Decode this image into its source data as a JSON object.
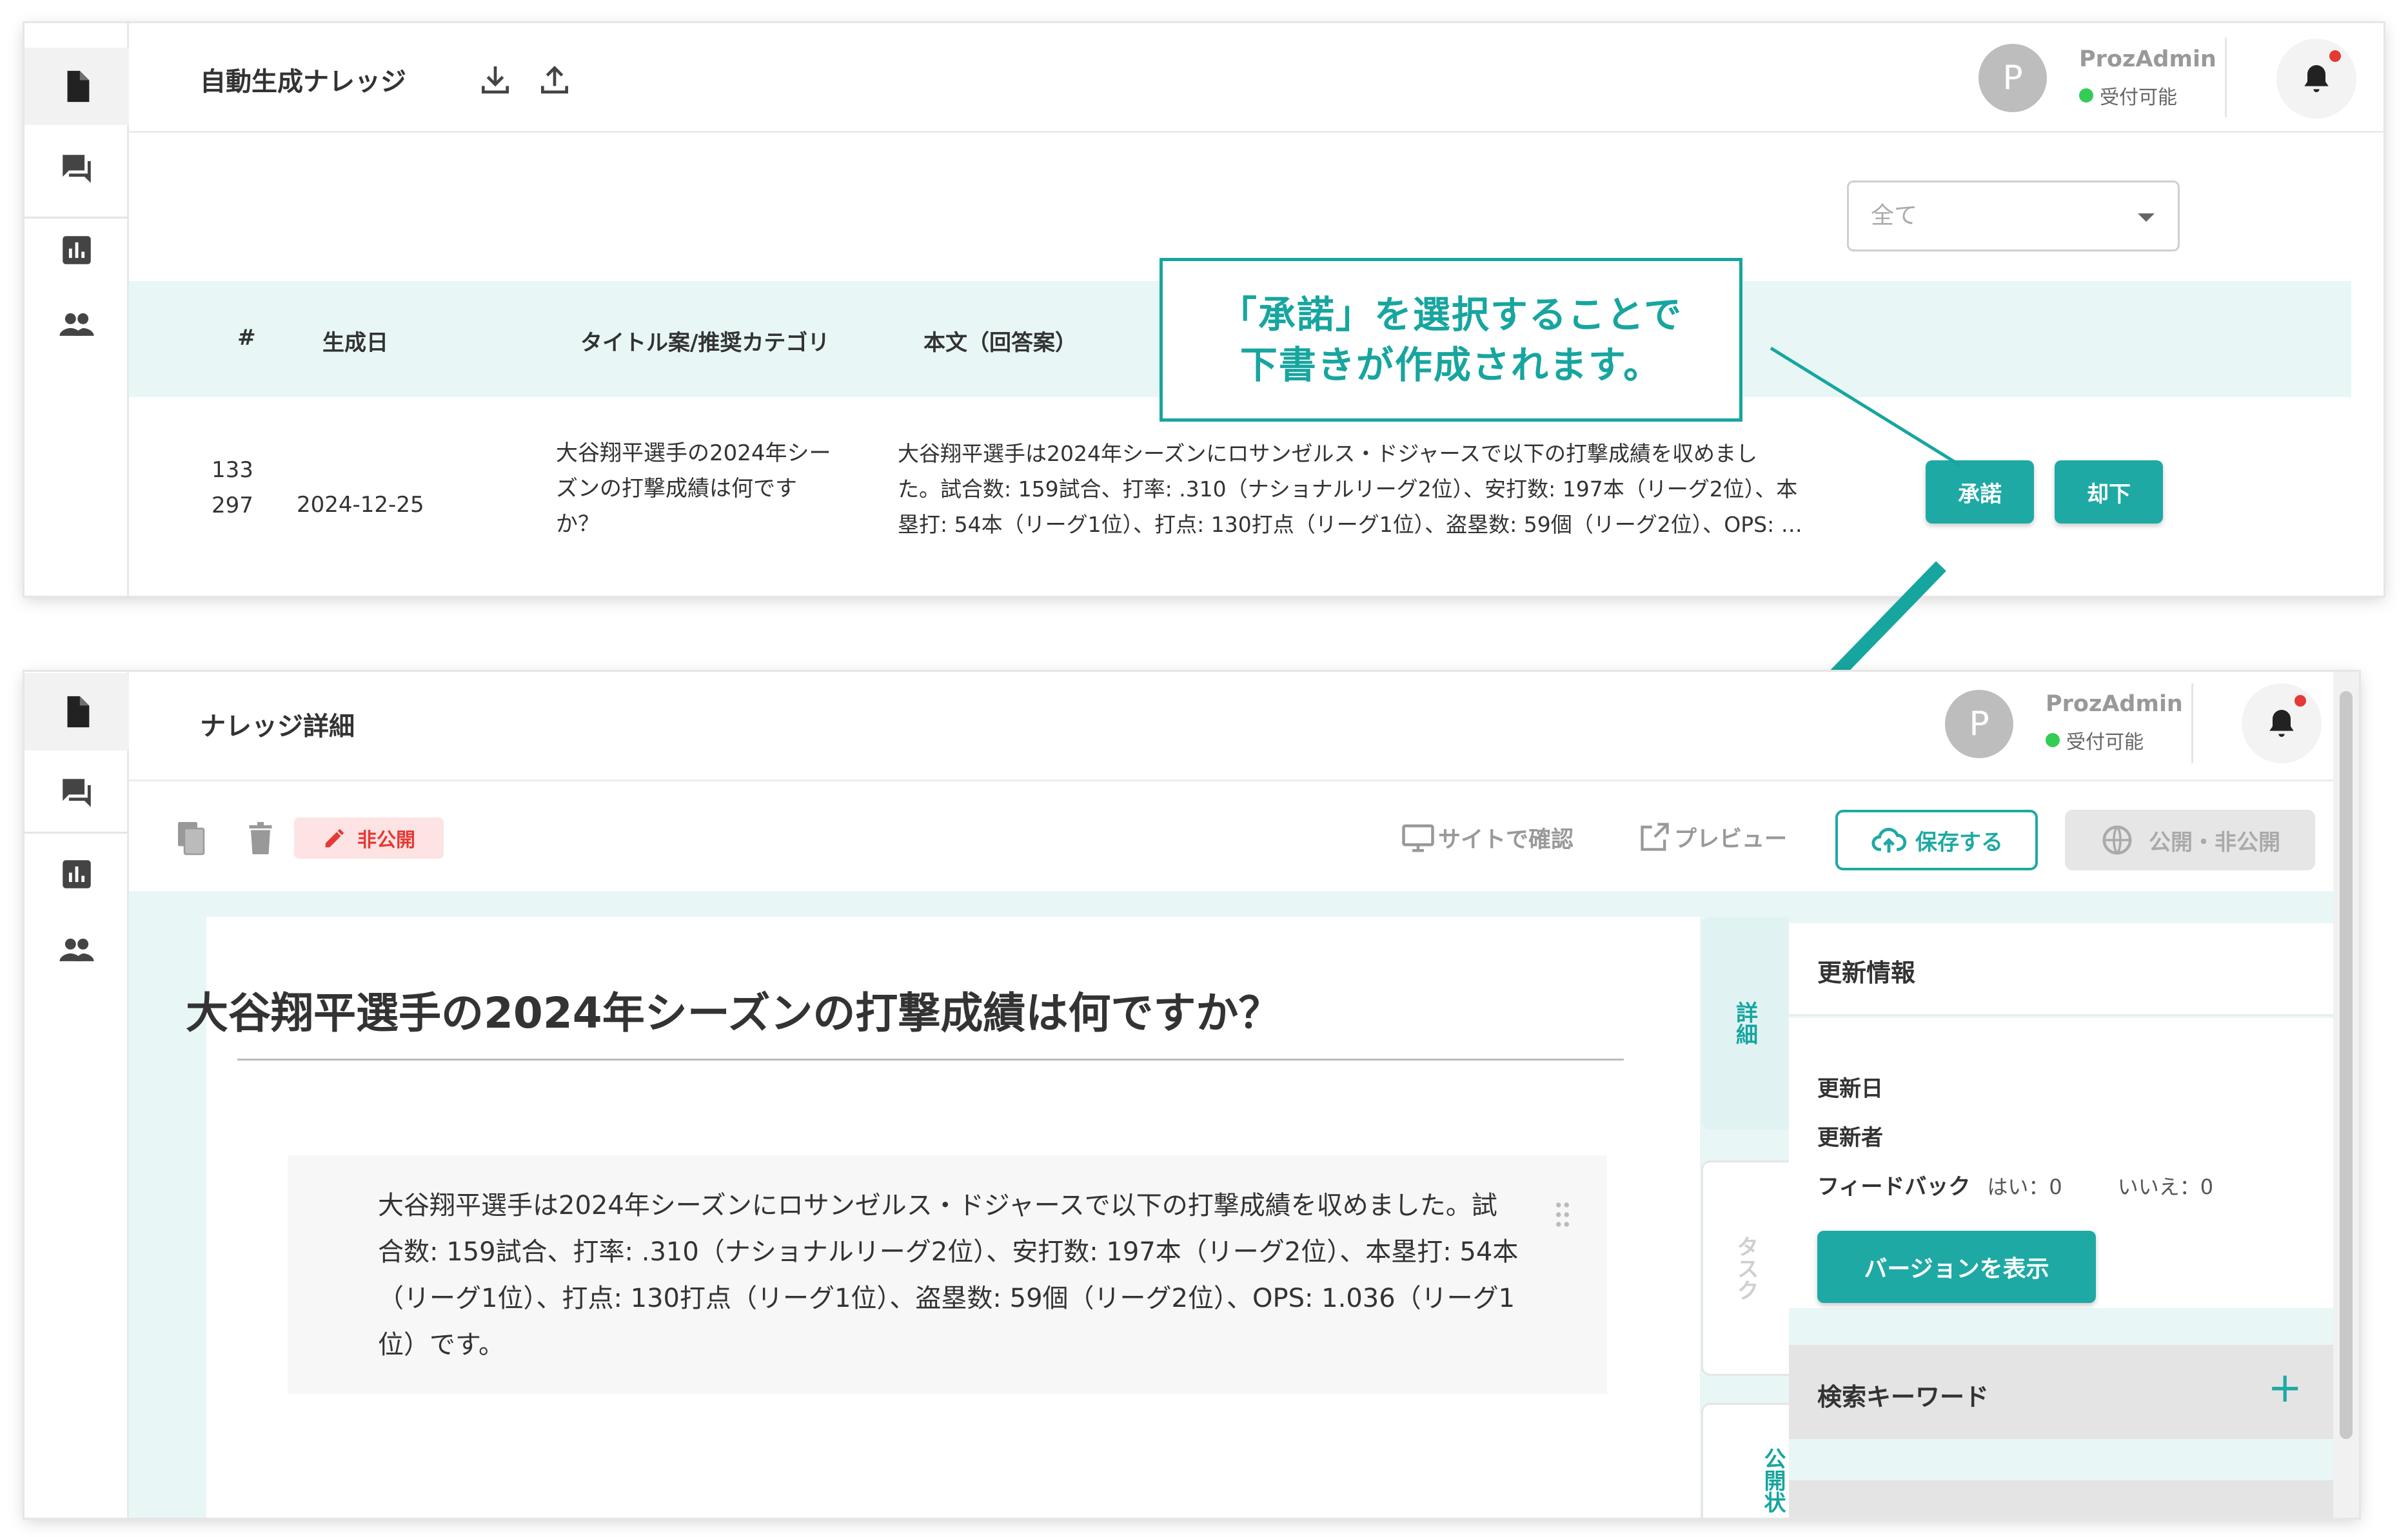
{
  "list_screen": {
    "title": "自動生成ナレッジ",
    "user": {
      "name": "ProzAdmin",
      "status": "受付可能"
    },
    "avatar_letter": "P",
    "filter": {
      "selected": "全て"
    },
    "table": {
      "headers": [
        "#",
        "生成日",
        "タイトル案/推奨カテゴリ",
        "本文（回答案）"
      ],
      "row": {
        "id_line1": "133",
        "id_line2": "297",
        "date": "2024-12-25",
        "title_lines": [
          "大谷翔平選手の2024年シー",
          "ズンの打撃成績は何です",
          "か？"
        ],
        "body_lines": [
          "大谷翔平選手は2024年シーズンにロサンゼルス・ドジャースで以下の打撃成績を収めまし",
          "た。試合数: 159試合、打率: .310（ナショナルリーグ2位）、安打数: 197本（リーグ2位）、本",
          "塁打: 54本（リーグ1位）、打点: 130打点（リーグ1位）、盗塁数: 59個（リーグ2位）、OPS: …"
        ],
        "approve_label": "承諾",
        "reject_label": "却下"
      }
    }
  },
  "callout": {
    "line1": "「承諾」を選択することで",
    "line2": "下書きが作成されます。"
  },
  "detail_screen": {
    "title": "ナレッジ詳細",
    "user": {
      "name": "ProzAdmin",
      "status": "受付可能"
    },
    "avatar_letter": "P",
    "status_tag": "非公開",
    "toolbar": {
      "view_on_site": "サイトで確認",
      "preview": "プレビュー",
      "save": "保存する",
      "publish_toggle": "公開・非公開"
    },
    "article": {
      "title": "大谷翔平選手の2024年シーズンの打撃成績は何ですか？",
      "body_lines": [
        "大谷翔平選手は2024年シーズンにロサンゼルス・ドジャースで以下の打撃成績を収めました。試",
        "合数: 159試合、打率: .310（ナショナルリーグ2位）、安打数: 197本（リーグ2位）、本塁打: 54本",
        "（リーグ1位）、打点: 130打点（リーグ1位）、盗塁数: 59個（リーグ2位）、OPS: 1.036（リーグ1",
        "位）です。"
      ]
    },
    "side_tabs": [
      "詳細",
      "タスク",
      "公開状"
    ],
    "update_info": {
      "heading": "更新情報",
      "updated_date_label": "更新日",
      "updated_by_label": "更新者",
      "feedback_label": "フィードバック",
      "feedback_yes": "はい：0",
      "feedback_no": "いいえ：0",
      "version_button": "バージョンを表示"
    },
    "search_keywords": {
      "heading": "検索キーワード",
      "add_icon": "+"
    }
  },
  "colors": {
    "accent": "#1ea9a4",
    "danger": "#e53935",
    "online": "#33cc55",
    "table_header_bg": "#e8f7f6"
  }
}
